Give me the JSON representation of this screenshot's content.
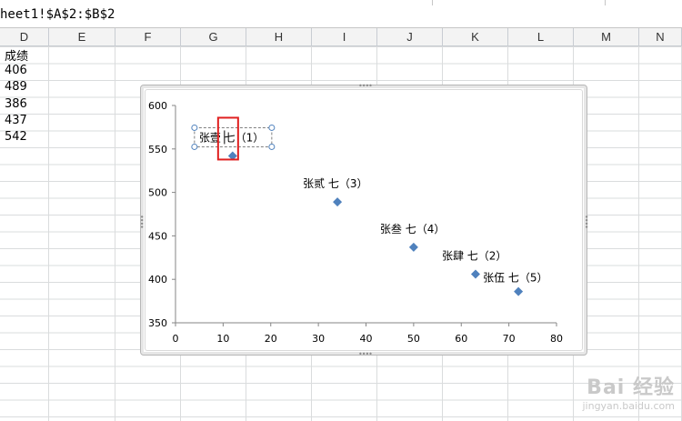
{
  "formula_bar": {
    "text": "heet1!$A$2:$B$2"
  },
  "columns": [
    "D",
    "E",
    "F",
    "G",
    "H",
    "I",
    "J",
    "K",
    "L",
    "M",
    "N"
  ],
  "column_d_cells": [
    "成绩",
    "406",
    "489",
    "386",
    "437",
    "542"
  ],
  "chart_data": {
    "type": "scatter",
    "x_ticks": [
      "0",
      "10",
      "20",
      "30",
      "40",
      "50",
      "60",
      "70",
      "80"
    ],
    "y_ticks": [
      "350",
      "400",
      "450",
      "500",
      "550",
      "600"
    ],
    "xlim": [
      0,
      80
    ],
    "ylim": [
      350,
      600
    ],
    "marker_color": "#4f81bd",
    "points": [
      {
        "x": 12,
        "y": 542,
        "label": "张壹 七（1）"
      },
      {
        "x": 34,
        "y": 489,
        "label": "张贰 七（3）"
      },
      {
        "x": 50,
        "y": 437,
        "label": "张叁 七（4）"
      },
      {
        "x": 63,
        "y": 406,
        "label": "张肆 七（2）"
      },
      {
        "x": 72,
        "y": 386,
        "label": "张伍 七（5）"
      }
    ],
    "selected_point_index": 0
  },
  "watermark": {
    "brand": "Bai 经验",
    "url": "jingyan.baidu.com"
  }
}
